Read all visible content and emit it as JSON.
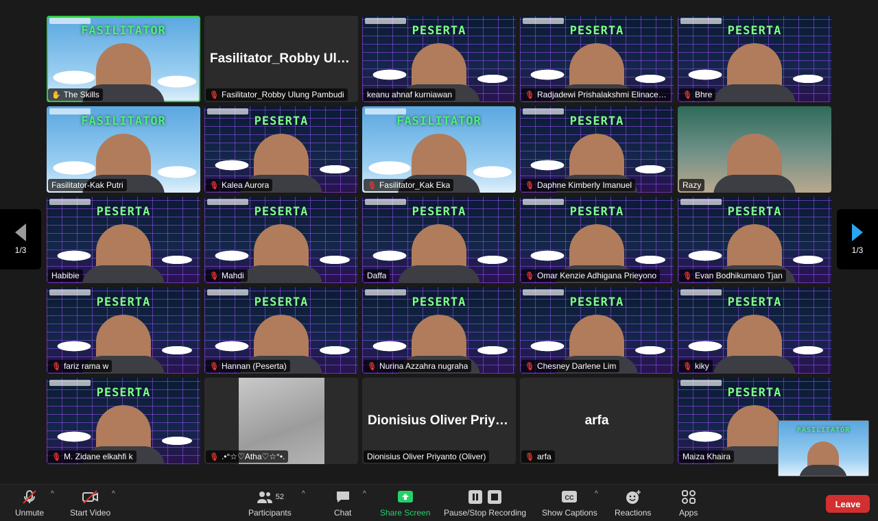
{
  "navigation": {
    "prev_page": "1/3",
    "next_page": "1/3"
  },
  "tiles": [
    {
      "name": "The Skills",
      "banner": "FASILITATOR",
      "bg": "fasil",
      "muted": false,
      "pinned": true,
      "active": true,
      "video": true
    },
    {
      "name": "Fasilitator_Robby Ulung Pambudi",
      "center": "Fasilitator_Robby Ulung Pambudi",
      "bg": "none",
      "muted": true,
      "video": false
    },
    {
      "name": "keanu ahnaf kurniawan",
      "banner": "PESERTA",
      "bg": "peserta",
      "muted": false,
      "video": true
    },
    {
      "name": "Radjadewi Prishalakshmi Elinacelestia",
      "banner": "PESERTA",
      "bg": "peserta",
      "muted": true,
      "video": true
    },
    {
      "name": "Bhre",
      "banner": "PESERTA",
      "bg": "peserta",
      "muted": true,
      "video": true
    },
    {
      "name": "Fasilitator-Kak Putri",
      "banner": "FASILITATOR",
      "bg": "fasil",
      "muted": false,
      "video": true
    },
    {
      "name": "Kalea Aurora",
      "banner": "PESERTA",
      "bg": "peserta",
      "muted": true,
      "video": true
    },
    {
      "name": "Fasilitator_Kak Eka",
      "banner": "FASILITATOR",
      "bg": "fasil",
      "muted": true,
      "video": true
    },
    {
      "name": "Daphne Kimberly Imanuel",
      "banner": "PESERTA",
      "bg": "peserta",
      "muted": true,
      "video": true
    },
    {
      "name": "Razy",
      "bg": "room",
      "muted": false,
      "video": true
    },
    {
      "name": "Habibie",
      "banner": "PESERTA",
      "bg": "peserta",
      "muted": false,
      "video": true
    },
    {
      "name": "Mahdi",
      "banner": "PESERTA",
      "bg": "peserta",
      "muted": true,
      "video": true
    },
    {
      "name": "Daffa",
      "banner": "PESERTA",
      "bg": "peserta",
      "muted": false,
      "video": true
    },
    {
      "name": "Omar Kenzie Adhigana Prieyono",
      "banner": "PESERTA",
      "bg": "peserta",
      "muted": true,
      "video": true
    },
    {
      "name": "Evan Bodhikumaro Tjan",
      "banner": "PESERTA",
      "bg": "peserta",
      "muted": true,
      "video": true
    },
    {
      "name": "fariz rama w",
      "banner": "PESERTA",
      "bg": "peserta",
      "muted": true,
      "video": true
    },
    {
      "name": "Hannan (Peserta)",
      "banner": "PESERTA",
      "bg": "peserta",
      "muted": true,
      "video": true
    },
    {
      "name": "Nurina Azzahra nugraha",
      "banner": "PESERTA",
      "bg": "peserta",
      "muted": true,
      "video": true
    },
    {
      "name": "Chesney Darlene Lim",
      "banner": "PESERTA",
      "bg": "peserta",
      "muted": true,
      "video": true
    },
    {
      "name": "kiky",
      "banner": "PESERTA",
      "bg": "peserta",
      "muted": true,
      "video": true
    },
    {
      "name": "M. Zidane elkahfi k",
      "banner": "PESERTA",
      "bg": "peserta",
      "muted": true,
      "video": true
    },
    {
      "name": ".•°☆♡Atha♡☆°•.",
      "bg": "wall",
      "muted": true,
      "video": true
    },
    {
      "name": "Dionisius Oliver Priyanto (Oliver)",
      "center": "Dionisius Oliver Priyanto (Oliver)",
      "bg": "none",
      "muted": false,
      "video": false
    },
    {
      "name": "arfa",
      "center": "arfa",
      "bg": "none",
      "muted": true,
      "video": false
    },
    {
      "name": "Maiza Khaira",
      "banner": "PESERTA",
      "bg": "peserta",
      "muted": false,
      "video": true
    }
  ],
  "self_view": {
    "banner": "FASILITATOR"
  },
  "toolbar": {
    "unmute": "Unmute",
    "start_video": "Start Video",
    "participants": "Participants",
    "participants_count": "52",
    "chat": "Chat",
    "share_screen": "Share Screen",
    "recording": "Pause/Stop Recording",
    "captions": "Show Captions",
    "reactions": "Reactions",
    "apps": "Apps",
    "leave": "Leave"
  },
  "colors": {
    "accent_green": "#23d36a",
    "leave_red": "#d32f2f",
    "muted_red": "#e2342b",
    "next_blue": "#2aa5ef"
  }
}
